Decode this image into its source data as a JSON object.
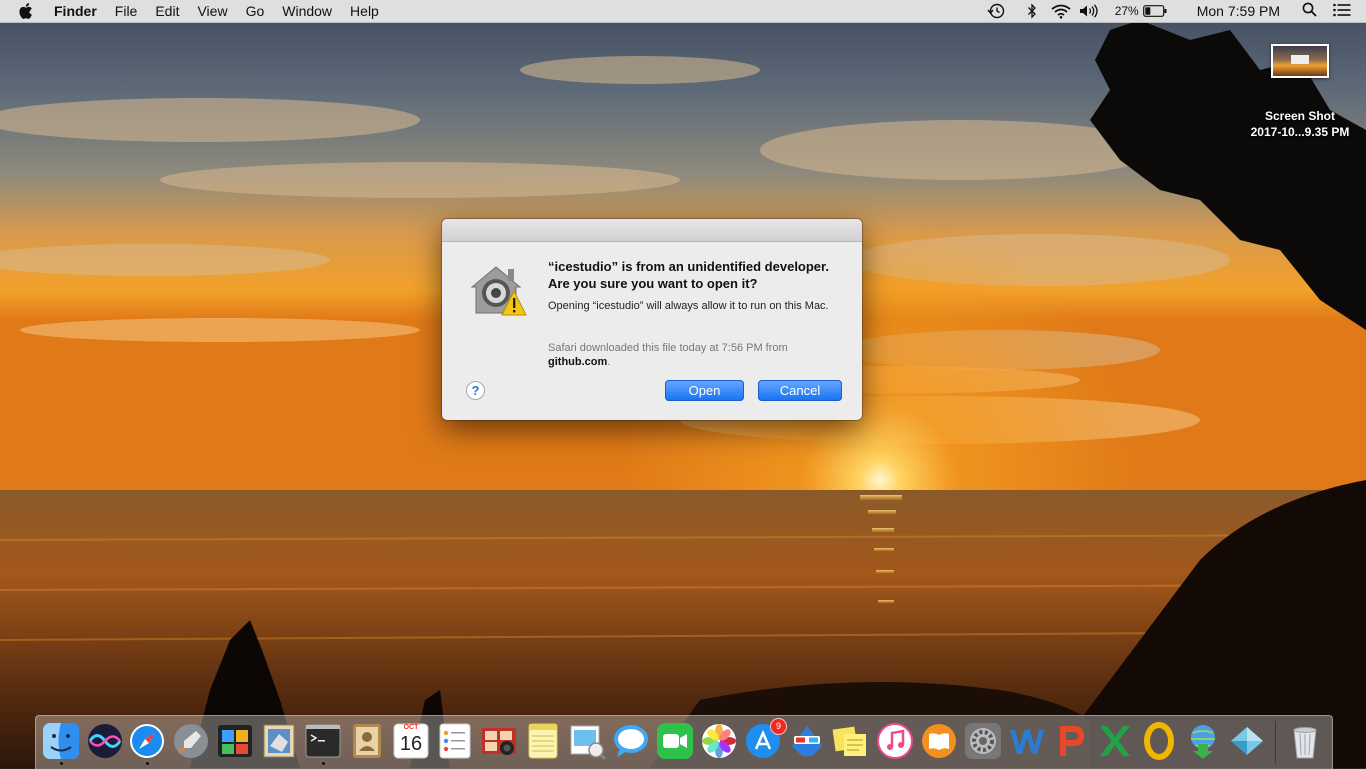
{
  "menubar": {
    "app_name": "Finder",
    "menus": [
      "File",
      "Edit",
      "View",
      "Go",
      "Window",
      "Help"
    ],
    "battery_percent": "27%",
    "clock": "Mon 7:59 PM"
  },
  "desktop": {
    "icon_label_line1": "Screen Shot",
    "icon_label_line2": "2017-10...9.35 PM"
  },
  "dialog": {
    "heading": "“icestudio” is from an unidentified developer. Are you sure you want to open it?",
    "message": "Opening “icestudio” will always allow it to run on this Mac.",
    "info_prefix": "Safari downloaded this file today at 7:56 PM from",
    "info_source": "github.com",
    "info_suffix": ".",
    "help_label": "?",
    "open_label": "Open",
    "cancel_label": "Cancel"
  },
  "dock": {
    "calendar_month": "OCT",
    "calendar_day": "16",
    "app_store_badge": "9",
    "items": [
      {
        "name": "finder-icon",
        "running": true
      },
      {
        "name": "siri-icon",
        "running": false
      },
      {
        "name": "safari-icon",
        "running": true
      },
      {
        "name": "launchpad-icon",
        "running": false
      },
      {
        "name": "photo-booth-icon",
        "running": false
      },
      {
        "name": "mail-icon",
        "running": false
      },
      {
        "name": "terminal-icon",
        "running": true
      },
      {
        "name": "contacts-icon",
        "running": false
      },
      {
        "name": "calendar-icon",
        "running": false
      },
      {
        "name": "reminders-icon",
        "running": false
      },
      {
        "name": "image-capture-icon",
        "running": false
      },
      {
        "name": "notes-icon",
        "running": false
      },
      {
        "name": "preview-icon",
        "running": false
      },
      {
        "name": "messages-icon",
        "running": false
      },
      {
        "name": "facetime-icon",
        "running": false
      },
      {
        "name": "photos-icon",
        "running": false
      },
      {
        "name": "app-store-icon",
        "running": false
      },
      {
        "name": "3d-glasses-app-icon",
        "running": false
      },
      {
        "name": "stickies-icon",
        "running": false
      },
      {
        "name": "itunes-icon",
        "running": false
      },
      {
        "name": "ibooks-icon",
        "running": false
      },
      {
        "name": "system-preferences-icon",
        "running": false
      },
      {
        "name": "word-icon",
        "running": false
      },
      {
        "name": "powerpoint-icon",
        "running": false
      },
      {
        "name": "excel-icon",
        "running": false
      },
      {
        "name": "outlook-icon",
        "running": false
      },
      {
        "name": "network-download-icon",
        "running": false
      },
      {
        "name": "icestudio-icon",
        "running": false
      },
      {
        "name": "trash-icon",
        "running": false
      }
    ]
  },
  "colors": {
    "accent_blue": "#1672f0",
    "badge_red": "#f0281e"
  }
}
